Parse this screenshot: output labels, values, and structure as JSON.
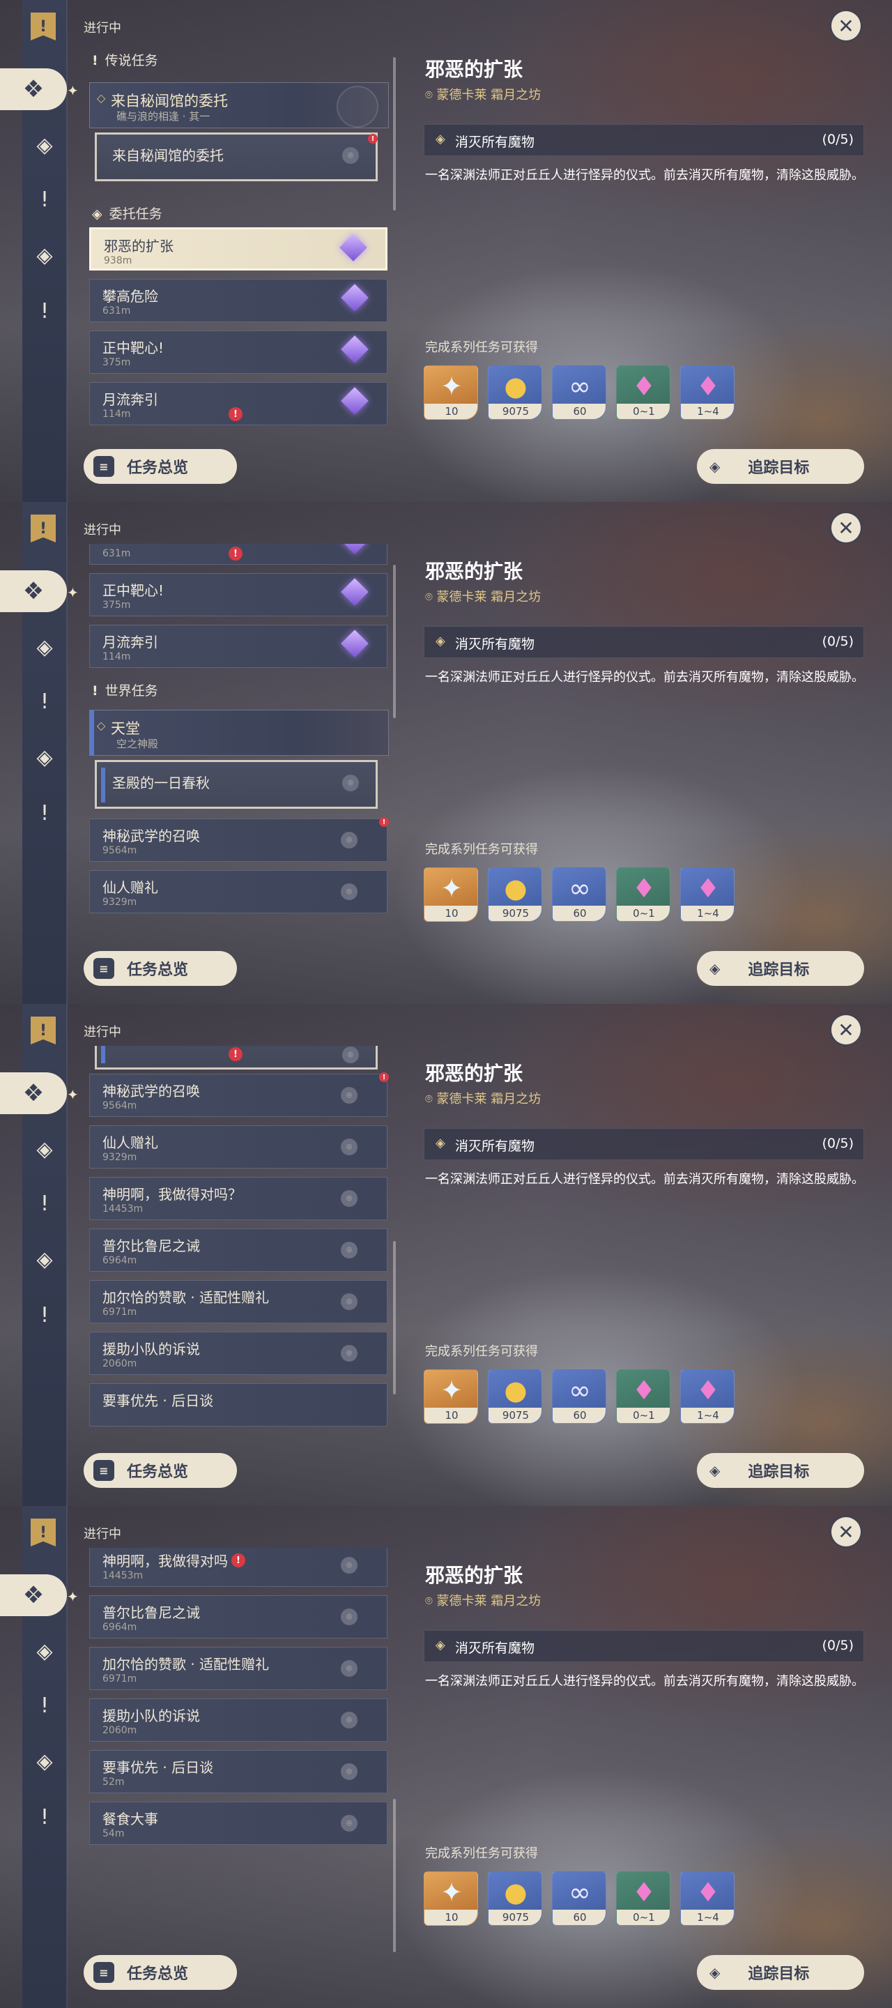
{
  "common": {
    "ongoing_label": "进行中",
    "overview_label": "任务总览",
    "track_label": "追踪目标",
    "close_glyph": "✕"
  },
  "detail": {
    "title": "邪恶的扩张",
    "location": "蒙德卡莱 霜月之坊",
    "objective": "消灭所有魔物",
    "progress": "(0/5)",
    "description": "一名深渊法师正对丘丘人进行怪异的仪式。前去消灭所有魔物，清除这股威胁。",
    "rewards_title": "完成系列任务可获得",
    "rewards": [
      {
        "icon": "primogem-icon",
        "count": "10"
      },
      {
        "icon": "mora-icon",
        "count": "9075"
      },
      {
        "icon": "intertwined-fate-icon",
        "count": "60"
      },
      {
        "icon": "crystal-chunk-icon",
        "count": "0~1"
      },
      {
        "icon": "crystal-cluster-icon",
        "count": "1~4"
      }
    ]
  },
  "list": {
    "cat_legend": "传说任务",
    "cat_commission": "委托任务",
    "cat_world": "世界任务",
    "legend_group_title": "来自秘闻馆的委托",
    "legend_group_sub": "礁与浪的相逢 · 其一",
    "legend_sub_quest": "来自秘闻馆的委托",
    "world_group_title": "天堂",
    "world_group_sub": "空之神殿",
    "world_sub_quest": "圣殿的一日春秋",
    "quests": {
      "q1": {
        "title": "邪恶的扩张",
        "dist": "938m"
      },
      "q2": {
        "title": "攀高危险",
        "dist": "631m"
      },
      "q3": {
        "title": "正中靶心!",
        "dist": "375m"
      },
      "q4": {
        "title": "月流奔引",
        "dist": "114m"
      },
      "w1": {
        "title": "神秘武学的召唤",
        "dist": "9564m"
      },
      "w2": {
        "title": "仙人赠礼",
        "dist": "9329m"
      },
      "w3": {
        "title": "神明啊，我做得对吗？",
        "dist": "14453m"
      },
      "w3b": {
        "title": "神明啊，我做得对吗",
        "dist": "14453m"
      },
      "w4": {
        "title": "普尔比鲁尼之诫",
        "dist": "6964m"
      },
      "w5": {
        "title": "加尔恰的赞歌 · 适配性赠礼",
        "dist": "6971m"
      },
      "w6": {
        "title": "援助小队的诉说",
        "dist": "2060m"
      },
      "w7": {
        "title": "要事优先 · 后日谈",
        "dist": "52m"
      },
      "w8": {
        "title": "餐食大事",
        "dist": "54m"
      }
    }
  },
  "colors": {
    "cream": "#ece4d2",
    "navy": "#3c4256",
    "gold_text": "#e2c889",
    "badge_red": "#d93a45",
    "quest_blue": "#5a79c8",
    "commission_purple": "#9b74f0"
  }
}
